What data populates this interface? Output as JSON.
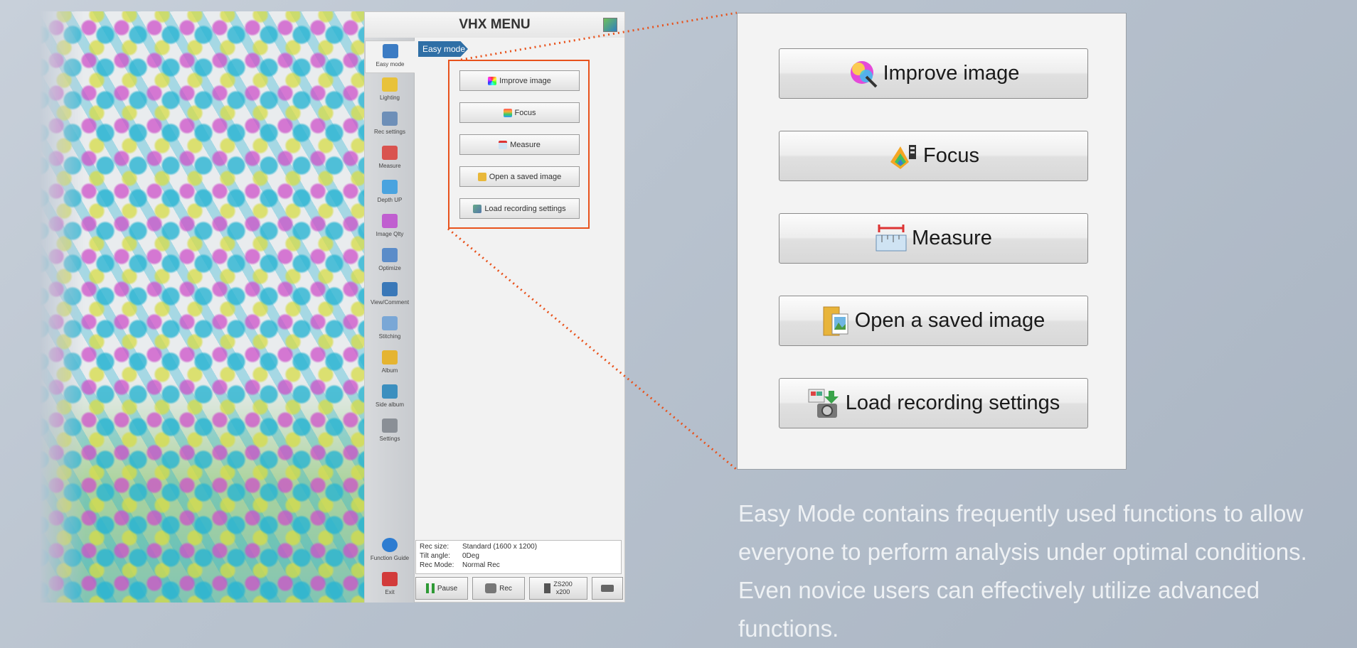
{
  "window": {
    "title": "VHX MENU"
  },
  "sidebar": {
    "items": [
      {
        "label": "Easy mode",
        "icon": "easy-mode-icon",
        "color": "#3c7cc4"
      },
      {
        "label": "Lighting",
        "icon": "lighting-icon",
        "color": "#e8c23a"
      },
      {
        "label": "Rec settings",
        "icon": "rec-settings-icon",
        "color": "#6e8fb8"
      },
      {
        "label": "Measure",
        "icon": "measure-icon",
        "color": "#d9534f"
      },
      {
        "label": "Depth UP",
        "icon": "depth-up-icon",
        "color": "#4aa3df"
      },
      {
        "label": "Image Qlty",
        "icon": "image-quality-icon",
        "color": "#c05fd0"
      },
      {
        "label": "Optimize",
        "icon": "optimize-icon",
        "color": "#5b8cc9"
      },
      {
        "label": "View/Comment",
        "icon": "view-comment-icon",
        "color": "#3a78b8"
      },
      {
        "label": "Stitching",
        "icon": "stitching-icon",
        "color": "#7aa7d6"
      },
      {
        "label": "Album",
        "icon": "album-icon",
        "color": "#e5b431"
      },
      {
        "label": "Side album",
        "icon": "side-album-icon",
        "color": "#3c8fbf"
      },
      {
        "label": "Settings",
        "icon": "settings-icon",
        "color": "#8a8f96"
      }
    ],
    "footer": [
      {
        "label": "Function Guide",
        "icon": "help-icon",
        "color": "#2d7cd1"
      },
      {
        "label": "Exit",
        "icon": "power-icon",
        "color": "#d23b3b"
      }
    ]
  },
  "mode_tab": {
    "label": "Easy mode"
  },
  "menu_buttons": [
    {
      "label": "Improve image",
      "icon": "improve-image-icon"
    },
    {
      "label": "Focus",
      "icon": "focus-icon"
    },
    {
      "label": "Measure",
      "icon": "measure-icon"
    },
    {
      "label": "Open a saved image",
      "icon": "folder-image-icon"
    },
    {
      "label": "Load recording settings",
      "icon": "load-settings-icon"
    }
  ],
  "status": {
    "rec_size_key": "Rec size:",
    "rec_size_val": "Standard (1600 x 1200)",
    "tilt_key": "Tilt angle:",
    "tilt_val": "0Deg",
    "rec_mode_key": "Rec Mode:",
    "rec_mode_val": "Normal Rec"
  },
  "bottom_bar": {
    "pause_label": "Pause",
    "rec_label": "Rec",
    "zoom_line1": "ZS200",
    "zoom_line2": "x200"
  },
  "description": "Easy Mode contains frequently used functions to allow everyone to perform analysis under optimal conditions. Even novice users can effectively utilize advanced functions.",
  "colors": {
    "accent": "#e8521c",
    "tab_blue": "#2f6fa6"
  }
}
